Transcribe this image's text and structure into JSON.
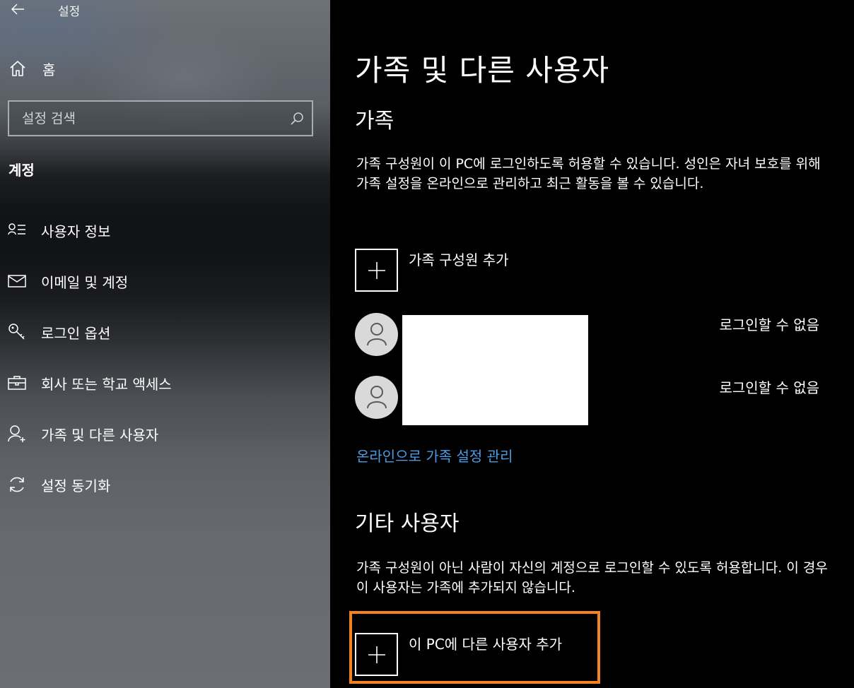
{
  "app": {
    "title": "설정"
  },
  "sidebar": {
    "home_label": "홈",
    "search_placeholder": "설정 검색",
    "section_label": "계정",
    "items": [
      {
        "label": "사용자 정보",
        "icon": "user-info-icon"
      },
      {
        "label": "이메일 및 계정",
        "icon": "mail-icon"
      },
      {
        "label": "로그인 옵션",
        "icon": "key-icon"
      },
      {
        "label": "회사 또는 학교 액세스",
        "icon": "briefcase-icon"
      },
      {
        "label": "가족 및 다른 사용자",
        "icon": "add-person-icon"
      },
      {
        "label": "설정 동기화",
        "icon": "sync-icon"
      }
    ]
  },
  "main": {
    "title": "가족 및 다른 사용자",
    "family": {
      "heading": "가족",
      "description": "가족 구성원이 이 PC에 로그인하도록 허용할 수 있습니다. 성인은 자녀 보호를 위해 가족 설정을 온라인으로 관리하고 최근 활동을 볼 수 있습니다.",
      "add_label": "가족 구성원 추가",
      "members": [
        {
          "status": "로그인할 수 없음"
        },
        {
          "status": "로그인할 수 없음"
        }
      ],
      "manage_link": "온라인으로 가족 설정 관리"
    },
    "other": {
      "heading": "기타 사용자",
      "description": "가족 구성원이 아닌 사람이 자신의 계정으로 로그인할 수 있도록 허용합니다. 이 경우 이 사용자는 가족에 추가되지 않습니다.",
      "add_label": "이 PC에 다른 사용자 추가"
    }
  },
  "colors": {
    "accent_link": "#4a9de4",
    "highlight": "#f58220"
  }
}
